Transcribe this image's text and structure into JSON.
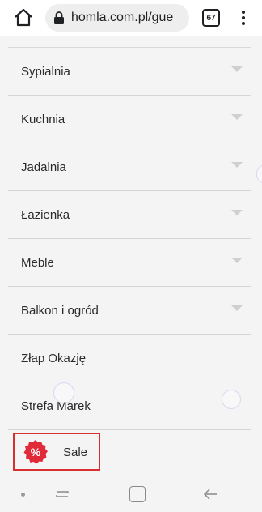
{
  "browser": {
    "url": "homla.com.pl/gue",
    "tab_count": "67"
  },
  "menu": {
    "items": [
      {
        "label": "Sypialnia",
        "has_submenu": true
      },
      {
        "label": "Kuchnia",
        "has_submenu": true
      },
      {
        "label": "Jadalnia",
        "has_submenu": true
      },
      {
        "label": "Łazienka",
        "has_submenu": true
      },
      {
        "label": "Meble",
        "has_submenu": true
      },
      {
        "label": "Balkon i ogród",
        "has_submenu": true
      },
      {
        "label": "Złap Okazję",
        "has_submenu": false
      },
      {
        "label": "Strefa Marek",
        "has_submenu": false
      }
    ],
    "sale": {
      "label": "Sale",
      "badge_symbol": "%",
      "badge_color": "#e02a3a",
      "highlight_color": "#d83030"
    }
  },
  "icons": {
    "home": "home-icon",
    "lock": "lock-icon",
    "tabs": "tabs-icon",
    "menu": "more-vert-icon",
    "chevron": "chevron-down-icon",
    "nav_recents": "recents-icon",
    "nav_home": "home-square-icon",
    "nav_back": "back-arrow-icon"
  }
}
